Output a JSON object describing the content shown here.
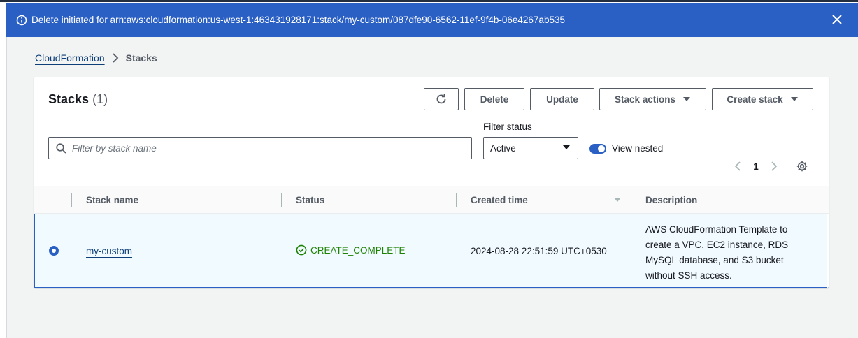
{
  "flash": {
    "message": "Delete initiated for arn:aws:cloudformation:us-west-1:463431928171:stack/my-custom/087dfe90-6562-11ef-9f4b-06e4267ab535",
    "color": "#2a5fc4"
  },
  "breadcrumb": {
    "root": "CloudFormation",
    "current": "Stacks"
  },
  "stacks": {
    "title": "Stacks",
    "count": "(1)",
    "buttons": {
      "delete": "Delete",
      "update": "Update",
      "stack_actions": "Stack actions",
      "create_stack": "Create stack"
    },
    "search_placeholder": "Filter by stack name",
    "filter_label": "Filter status",
    "filter_value": "Active",
    "view_nested": "View nested",
    "page": "1",
    "columns": {
      "name": "Stack name",
      "status": "Status",
      "created": "Created time",
      "description": "Description"
    },
    "rows": [
      {
        "name": "my-custom",
        "status": "CREATE_COMPLETE",
        "created": "2024-08-28 22:51:59 UTC+0530",
        "description": "AWS CloudFormation Template to create a VPC, EC2 instance, RDS MySQL database, and S3 bucket without SSH access."
      }
    ]
  },
  "colors": {
    "accent": "#2a5fc4",
    "success": "#1d8102",
    "link": "#0f3f78"
  }
}
